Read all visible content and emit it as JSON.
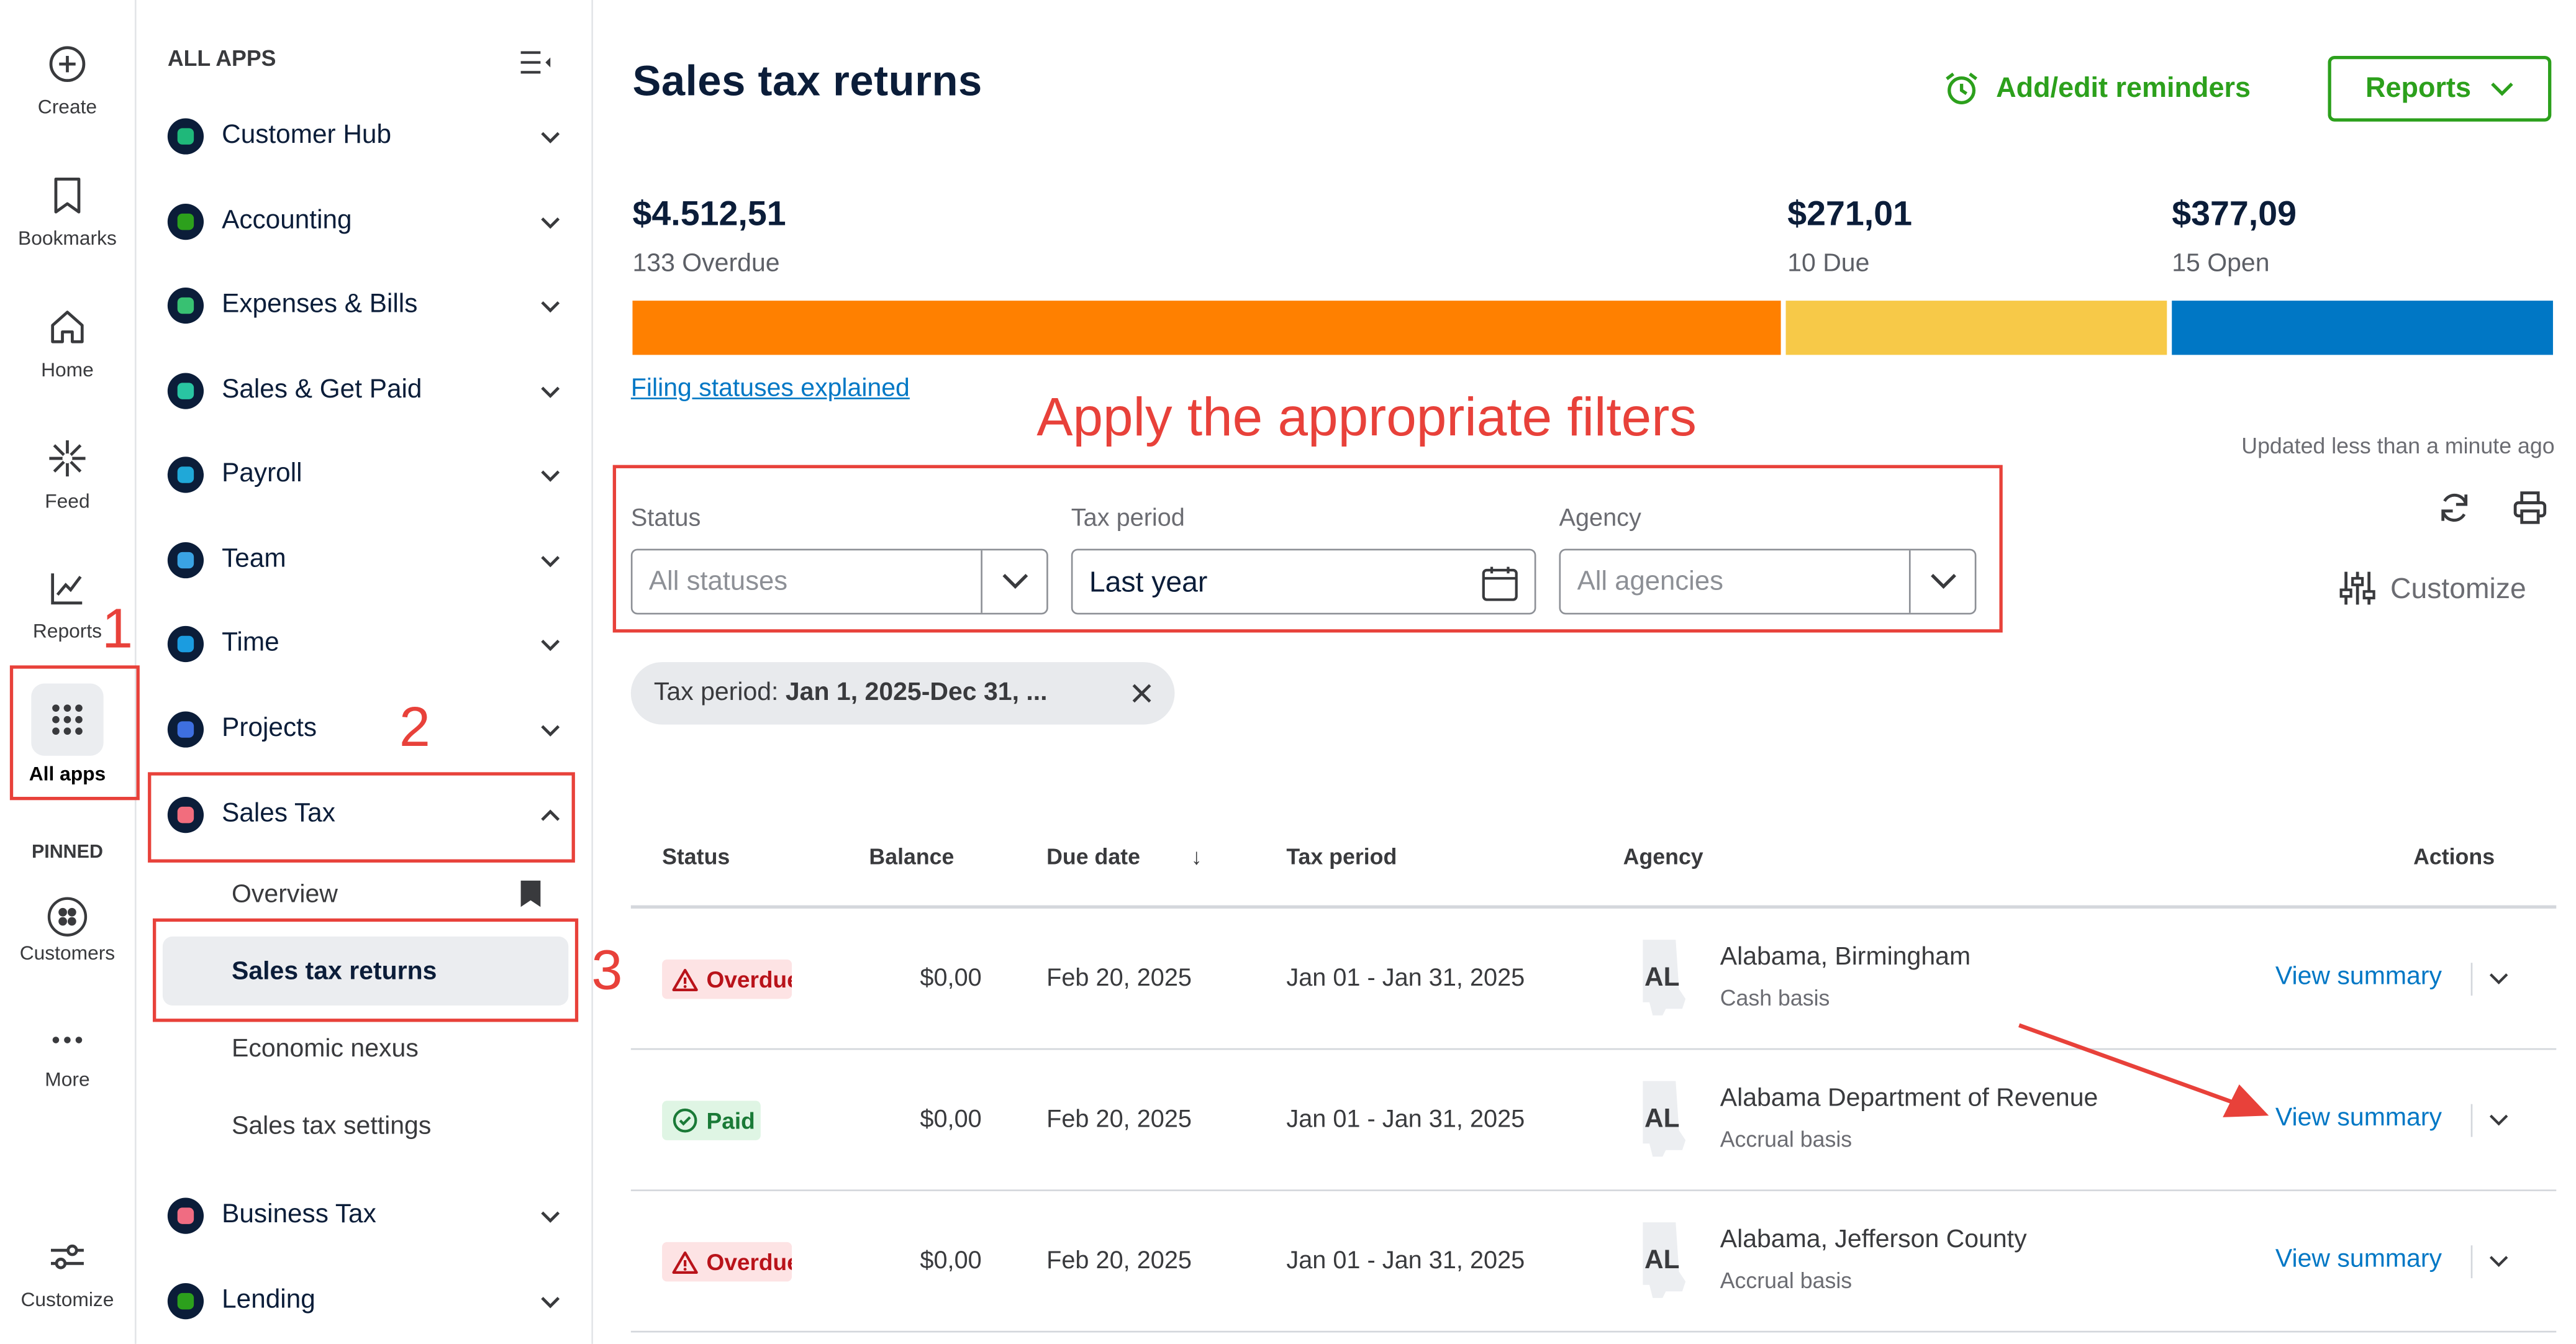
{
  "rail": {
    "items": [
      {
        "label": "Create",
        "icon": "plus-circle-icon"
      },
      {
        "label": "Bookmarks",
        "icon": "bookmark-icon"
      },
      {
        "label": "Home",
        "icon": "home-icon"
      },
      {
        "label": "Feed",
        "icon": "sparkle-icon"
      },
      {
        "label": "Reports",
        "icon": "line-chart-icon"
      },
      {
        "label": "All apps",
        "icon": "grid-icon"
      }
    ],
    "pinned_heading": "PINNED",
    "pinned": [
      {
        "label": "Customers",
        "icon": "customers-icon"
      },
      {
        "label": "More",
        "icon": "more-icon"
      }
    ],
    "customize_label": "Customize"
  },
  "apps": {
    "heading": "ALL APPS",
    "items": [
      {
        "label": "Customer Hub",
        "color": "#1fb87a"
      },
      {
        "label": "Accounting",
        "color": "#2ca01c"
      },
      {
        "label": "Expenses & Bills",
        "color": "#38c172"
      },
      {
        "label": "Sales & Get Paid",
        "color": "#29c5a2"
      },
      {
        "label": "Payroll",
        "color": "#20a8d8"
      },
      {
        "label": "Team",
        "color": "#3aa3e3"
      },
      {
        "label": "Time",
        "color": "#1b9ce0"
      },
      {
        "label": "Projects",
        "color": "#3e6fe0"
      },
      {
        "label": "Sales Tax",
        "color": "#f26d7d"
      },
      {
        "label": "Business Tax",
        "color": "#f06c82"
      },
      {
        "label": "Lending",
        "color": "#2ca01c"
      }
    ],
    "sales_tax_sub": [
      {
        "label": "Overview"
      },
      {
        "label": "Sales tax returns"
      },
      {
        "label": "Economic nexus"
      },
      {
        "label": "Sales tax settings"
      }
    ]
  },
  "header": {
    "title": "Sales tax returns",
    "reminders_label": "Add/edit reminders",
    "reports_label": "Reports"
  },
  "summary": {
    "overdue": {
      "amount": "$4.512,51",
      "label": "133 Overdue",
      "color": "#ff8000"
    },
    "due": {
      "amount": "$271,01",
      "label": "10 Due",
      "color": "#f7c948"
    },
    "open": {
      "amount": "$377,09",
      "label": "15 Open",
      "color": "#0077c5"
    },
    "filing_link": "Filing statuses explained"
  },
  "filters": {
    "status_label": "Status",
    "status_value": "All statuses",
    "tax_period_label": "Tax period",
    "tax_period_value": "Last year",
    "agency_label": "Agency",
    "agency_value": "All agencies",
    "chip": "Tax period: ",
    "chip_value": "Jan 1, 2025-Dec 31, ..."
  },
  "toolbar": {
    "updated": "Updated less than a minute ago",
    "customize_label": "Customize"
  },
  "table": {
    "headers": [
      "Status",
      "Balance",
      "Due date",
      "Tax period",
      "Agency",
      "Actions"
    ],
    "sort_indicator": "↓",
    "rows": [
      {
        "status": "Overdue",
        "balance": "$0,00",
        "due": "Feb 20, 2025",
        "period": "Jan 01 - Jan 31, 2025",
        "state": "AL",
        "agency": "Alabama, Birmingham",
        "basis": "Cash basis",
        "action": "View summary"
      },
      {
        "status": "Paid",
        "balance": "$0,00",
        "due": "Feb 20, 2025",
        "period": "Jan 01 - Jan 31, 2025",
        "state": "AL",
        "agency": "Alabama Department of Revenue",
        "basis": "Accrual basis",
        "action": "View summary"
      },
      {
        "status": "Overdue",
        "balance": "$0,00",
        "due": "Feb 20, 2025",
        "period": "Jan 01 - Jan 31, 2025",
        "state": "AL",
        "agency": "Alabama, Jefferson County",
        "basis": "Accrual basis",
        "action": "View summary"
      }
    ]
  },
  "annotations": {
    "filters_note": "Apply the appropriate filters",
    "step1": "1",
    "step2": "2",
    "step3": "3",
    "color": "#e8413a"
  }
}
